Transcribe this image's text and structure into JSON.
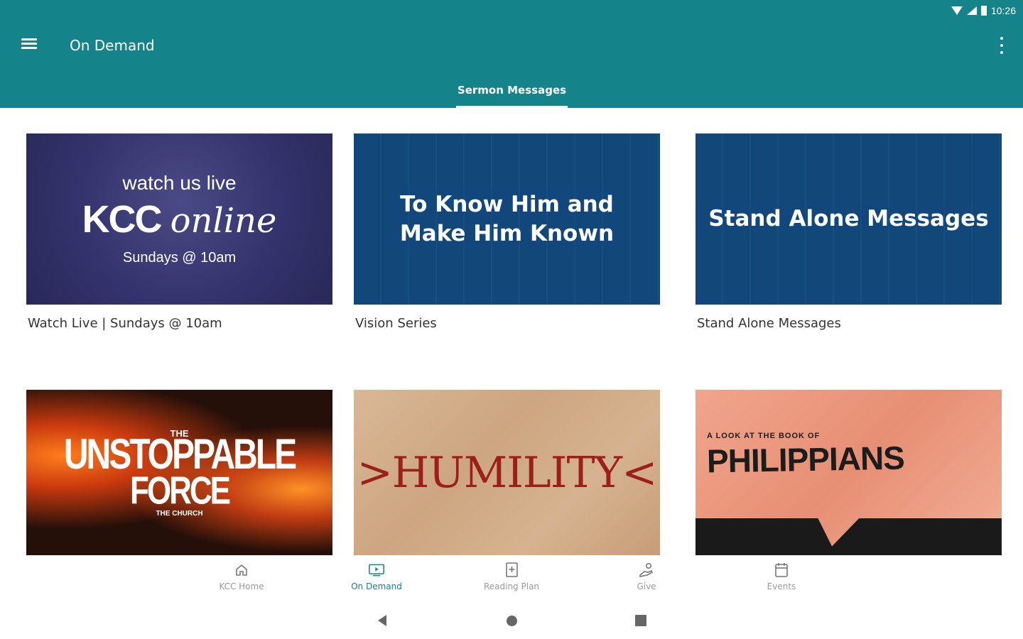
{
  "status_bar": {
    "time": "10:26"
  },
  "app_bar": {
    "title": "On Demand"
  },
  "tabs": [
    {
      "label": "Sermon Messages",
      "selected": true
    }
  ],
  "cards": [
    {
      "caption": "Watch Live | Sundays @ 10am",
      "thumb": {
        "line1": "watch us live",
        "line2a": "KCC",
        "line2b": "online",
        "line3": "Sundays @ 10am"
      }
    },
    {
      "caption": "Vision Series",
      "thumb": {
        "line1": "To Know Him and",
        "line2": "Make Him Known"
      }
    },
    {
      "caption": "Stand Alone Messages",
      "thumb": {
        "line1": "Stand Alone Messages"
      }
    },
    {
      "caption": "",
      "thumb": {
        "line1": "THE",
        "line2": "UNSTOPPABLE",
        "line3": "FORCE",
        "line4": "THE CHURCH"
      }
    },
    {
      "caption": "",
      "thumb": {
        "line1": ">HUMILITY<"
      }
    },
    {
      "caption": "",
      "thumb": {
        "line1": "A LOOK AT THE BOOK OF",
        "line2": "PHILIPPIANS"
      }
    }
  ],
  "bottom_nav": [
    {
      "label": "KCC Home",
      "icon": "home-icon",
      "active": false
    },
    {
      "label": "On Demand",
      "icon": "tv-play-icon",
      "active": true
    },
    {
      "label": "Reading Plan",
      "icon": "book-plus-icon",
      "active": false
    },
    {
      "label": "Give",
      "icon": "give-hand-icon",
      "active": false
    },
    {
      "label": "Events",
      "icon": "calendar-icon",
      "active": false
    }
  ],
  "colors": {
    "primary": "#14838a",
    "active_nav": "#14838a"
  }
}
